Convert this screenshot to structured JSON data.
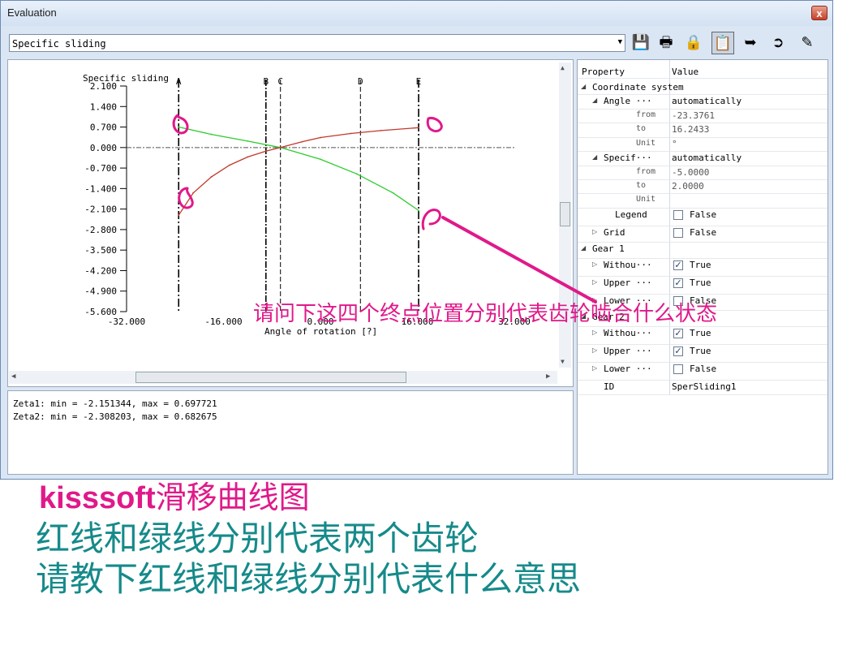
{
  "window": {
    "title": "Evaluation",
    "close_glyph": "x"
  },
  "toolbar": {
    "dropdown_value": "Specific sliding",
    "buttons": [
      {
        "icon": "save-icon",
        "glyph": "💾"
      },
      {
        "icon": "print-icon",
        "glyph": "🖶"
      },
      {
        "icon": "lock-icon",
        "glyph": "🔒"
      },
      {
        "icon": "properties-icon",
        "glyph": "📋"
      },
      {
        "icon": "export-icon",
        "glyph": "➥"
      },
      {
        "icon": "arrow-right-icon",
        "glyph": "➲"
      },
      {
        "icon": "edit-icon",
        "glyph": "✎"
      }
    ]
  },
  "chart_data": {
    "type": "line",
    "title": "Specific sliding",
    "xlabel": "Angle of rotation [?]",
    "ylabel": "",
    "xlim": [
      -32,
      32
    ],
    "ylim": [
      -5.6,
      2.1
    ],
    "x_ticks": [
      "-32.000",
      "-16.000",
      "0.000",
      "16.000",
      "32.000"
    ],
    "y_ticks": [
      "2.100",
      "1.400",
      "0.700",
      "0.000",
      "-0.700",
      "-1.400",
      "-2.100",
      "-2.800",
      "-3.500",
      "-4.200",
      "-4.900",
      "-5.600"
    ],
    "markers": [
      {
        "label": "A",
        "x": -23.4
      },
      {
        "label": "B",
        "x": -9.0
      },
      {
        "label": "C",
        "x": -6.6
      },
      {
        "label": "D",
        "x": 6.6
      },
      {
        "label": "E",
        "x": 16.2
      }
    ],
    "series": [
      {
        "color": "#2ecc2e",
        "x": [
          -23.4,
          -18,
          -12,
          -6.6,
          0,
          6,
          12,
          16.2
        ],
        "y": [
          0.7,
          0.45,
          0.22,
          0.0,
          -0.4,
          -0.9,
          -1.55,
          -2.15
        ]
      },
      {
        "color": "#c0392b",
        "x": [
          -23.4,
          -21,
          -18,
          -15,
          -12,
          -9,
          -6.6,
          -3,
          0,
          5,
          10,
          16.2
        ],
        "y": [
          -2.31,
          -1.55,
          -1.0,
          -0.6,
          -0.32,
          -0.12,
          0.0,
          0.2,
          0.34,
          0.48,
          0.58,
          0.68
        ]
      }
    ]
  },
  "output": {
    "line1": "Zeta1: min = -2.151344, max = 0.697721",
    "line2": "Zeta2: min = -2.308203, max = 0.682675"
  },
  "properties": {
    "header_property": "Property",
    "header_value": "Value",
    "rows": [
      {
        "label": "Coordinate system",
        "value": "",
        "indent": 0,
        "tri": "◢",
        "check": null
      },
      {
        "label": "Angle ···",
        "value": "automatically",
        "indent": 1,
        "tri": "◢",
        "check": null
      },
      {
        "label": "from",
        "value": "-23.3761",
        "indent": 3,
        "tri": "",
        "check": null
      },
      {
        "label": "to",
        "value": "16.2433",
        "indent": 3,
        "tri": "",
        "check": null
      },
      {
        "label": "Unit",
        "value": "°",
        "indent": 3,
        "tri": "",
        "check": null
      },
      {
        "label": "Specif···",
        "value": "automatically",
        "indent": 1,
        "tri": "◢",
        "check": null
      },
      {
        "label": "from",
        "value": "-5.0000",
        "indent": 3,
        "tri": "",
        "check": null
      },
      {
        "label": "to",
        "value": "2.0000",
        "indent": 3,
        "tri": "",
        "check": null
      },
      {
        "label": "Unit",
        "value": "",
        "indent": 3,
        "tri": "",
        "check": null
      },
      {
        "label": "Legend",
        "value": "False",
        "indent": 2,
        "tri": "",
        "check": false
      },
      {
        "label": "Grid",
        "value": "False",
        "indent": 1,
        "tri": "▷",
        "check": false
      },
      {
        "label": "Gear 1",
        "value": "",
        "indent": 0,
        "tri": "◢",
        "check": null
      },
      {
        "label": "Withou···",
        "value": "True",
        "indent": 1,
        "tri": "▷",
        "check": true
      },
      {
        "label": "Upper ···",
        "value": "True",
        "indent": 1,
        "tri": "▷",
        "check": true
      },
      {
        "label": "Lower ···",
        "value": "False",
        "indent": 1,
        "tri": "▷",
        "check": false
      },
      {
        "label": "Gear 2",
        "value": "",
        "indent": 0,
        "tri": "◢",
        "check": null
      },
      {
        "label": "Withou···",
        "value": "True",
        "indent": 1,
        "tri": "▷",
        "check": true
      },
      {
        "label": "Upper ···",
        "value": "True",
        "indent": 1,
        "tri": "▷",
        "check": true
      },
      {
        "label": "Lower ···",
        "value": "False",
        "indent": 1,
        "tri": "▷",
        "check": false
      },
      {
        "label": "ID",
        "value": "SperSliding1",
        "indent": 1,
        "tri": "",
        "check": null
      }
    ]
  },
  "annotations": {
    "question": "请问下这四个终点位置分别代表齿轮啮合什么状态",
    "brand": "kisssoft",
    "heading": "滑移曲线图",
    "line1": "红线和绿线分别代表两个齿轮",
    "line2": "请教下红线和绿线分别代表什么意思",
    "marker_color": "#e0198a",
    "teal_color": "#168a8a"
  }
}
